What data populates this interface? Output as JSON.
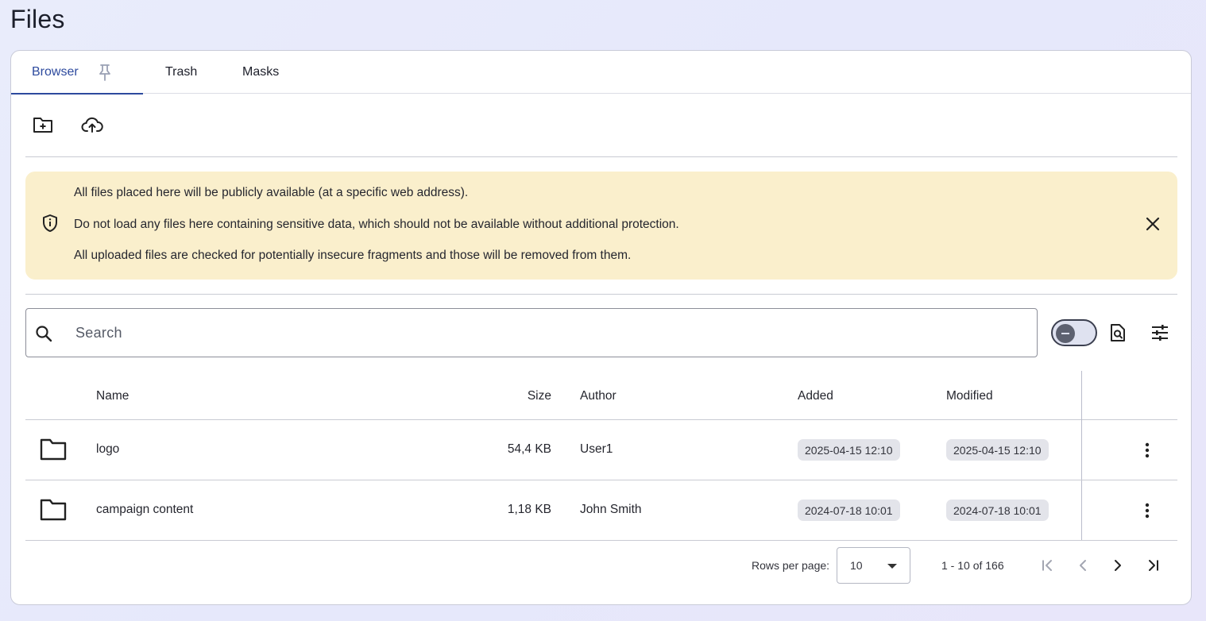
{
  "page": {
    "title": "Files"
  },
  "tabs": [
    {
      "label": "Browser",
      "active": true
    },
    {
      "label": "Trash",
      "active": false
    },
    {
      "label": "Masks",
      "active": false
    }
  ],
  "toolbar": {
    "new_folder_icon": "folder-plus-icon",
    "upload_icon": "cloud-upload-icon"
  },
  "banner": {
    "lines": [
      "All files placed here will be publicly available (at a specific web address).",
      "Do not load any files here containing sensitive data, which should not be available without additional protection.",
      "All uploaded files are checked for potentially insecure fragments and those will be removed from them."
    ],
    "background": "#faefcc"
  },
  "search": {
    "placeholder": "Search",
    "value": ""
  },
  "table": {
    "columns": {
      "name": "Name",
      "size": "Size",
      "author": "Author",
      "added": "Added",
      "modified": "Modified"
    },
    "rows": [
      {
        "name": "logo",
        "size": "54,4 KB",
        "author": "User1",
        "added": "2025-04-15 12:10",
        "modified": "2025-04-15 12:10"
      },
      {
        "name": "campaign content",
        "size": "1,18 KB",
        "author": "John Smith",
        "added": "2024-07-18 10:01",
        "modified": "2024-07-18 10:01"
      }
    ]
  },
  "pagination": {
    "rows_per_page_label": "Rows per page:",
    "rows_per_page": "10",
    "range": "1 - 10 of 166"
  },
  "colors": {
    "accent": "#2d4a9e",
    "chip": "#e3e4ea"
  }
}
